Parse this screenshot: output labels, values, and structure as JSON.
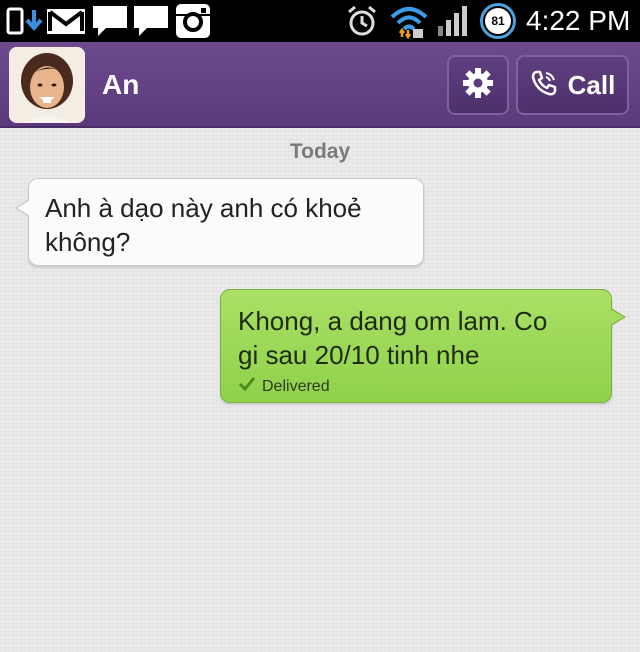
{
  "status_bar": {
    "icons": [
      "sim-download-icon",
      "gmail-icon",
      "message-icon",
      "message-icon",
      "instagram-icon",
      "alarm-icon",
      "wifi-icon",
      "signal-icon"
    ],
    "battery_level": "81",
    "time": "4:22 PM"
  },
  "header": {
    "contact_name": "An",
    "settings_icon": "gear-icon",
    "call_icon": "phone-icon",
    "call_label": "Call",
    "accent_color": "#5b3a7c"
  },
  "conversation": {
    "date_separator": "Today",
    "messages": [
      {
        "direction": "incoming",
        "lines": [
          "Anh à dạo này anh có khoẻ",
          "không?"
        ]
      },
      {
        "direction": "outgoing",
        "lines": [
          "Khong, a dang om lam. Co",
          "gi sau 20/10 tinh nhe"
        ],
        "status": "Delivered",
        "bubble_color": "#9ad653"
      }
    ]
  }
}
